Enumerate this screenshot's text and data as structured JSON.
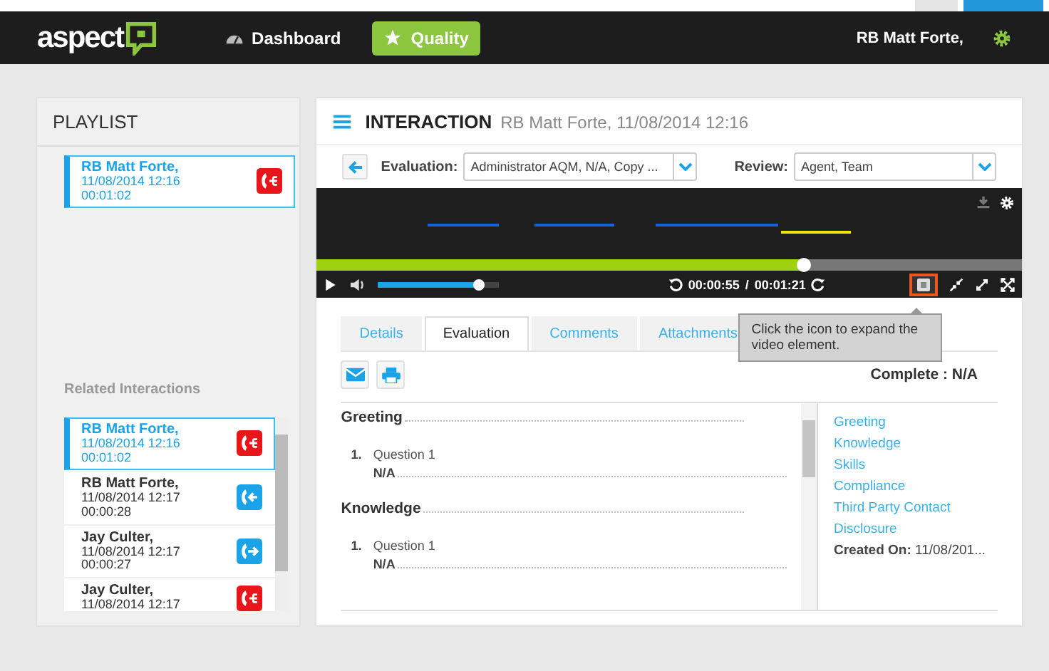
{
  "nav": {
    "logo": "aspect",
    "items": [
      {
        "label": "Dashboard",
        "kind": "gauge",
        "selected": false
      },
      {
        "label": "Quality",
        "kind": "star",
        "selected": true
      }
    ],
    "user": "RB Matt Forte,"
  },
  "playlist": {
    "title": "PLAYLIST",
    "items": [
      {
        "name": "RB Matt Forte,",
        "date": "11/08/2014 12:16",
        "duration": "00:01:02",
        "kind": "transfer",
        "selected": true
      }
    ]
  },
  "related": {
    "title": "Related Interactions",
    "items": [
      {
        "name": "RB Matt Forte,",
        "date": "11/08/2014 12:16",
        "duration": "00:01:02",
        "kind": "transfer",
        "selected": true
      },
      {
        "name": "RB Matt Forte,",
        "date": "11/08/2014 12:17",
        "duration": "00:00:28",
        "kind": "incoming",
        "selected": false
      },
      {
        "name": "Jay Culter,",
        "date": "11/08/2014 12:17",
        "duration": "00:00:27",
        "kind": "outgoing",
        "selected": false
      },
      {
        "name": "Jay Culter,",
        "date": "11/08/2014 12:17",
        "kind": "transfer",
        "selected": false
      }
    ]
  },
  "interaction": {
    "title": "INTERACTION",
    "subtitle": "RB Matt Forte, 11/08/2014 12:16",
    "evaluation": {
      "label": "Evaluation:",
      "value": "Administrator AQM, N/A, Copy ..."
    },
    "review": {
      "label": "Review:",
      "value": "Agent, Team"
    }
  },
  "player": {
    "progress": {
      "level": 0.69
    },
    "volume": {
      "level": 0.83
    },
    "current": "00:00:55",
    "separator": "/",
    "total": "00:01:21"
  },
  "tooltip": "Click the icon to expand the video element.",
  "tabs": [
    {
      "label": "Details",
      "selected": false
    },
    {
      "label": "Evaluation",
      "selected": true
    },
    {
      "label": "Comments",
      "selected": false
    },
    {
      "label": "Attachments",
      "selected": false
    }
  ],
  "status": "Complete : N/A",
  "sections": [
    {
      "title": "Greeting",
      "questions": [
        {
          "number": "1.",
          "text": "Question 1",
          "answer": "N/A"
        }
      ]
    },
    {
      "title": "Knowledge",
      "questions": [
        {
          "number": "1.",
          "text": "Question 1",
          "answer": "N/A"
        }
      ]
    }
  ],
  "section_links": [
    "Greeting",
    "Knowledge",
    "Skills",
    "Compliance",
    "Third Party Contact",
    "Disclosure"
  ],
  "created": {
    "label": "Created On:",
    "value": "11/08/201..."
  }
}
